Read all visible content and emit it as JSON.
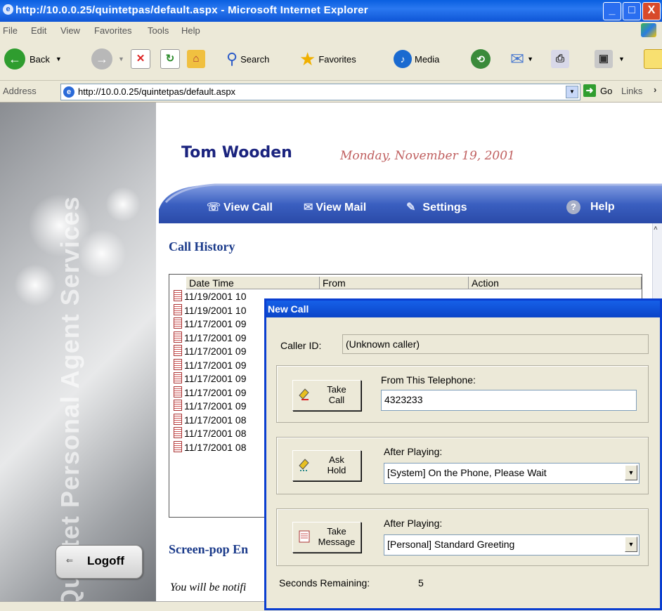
{
  "window": {
    "title": "http://10.0.0.25/quintetpas/default.aspx - Microsoft Internet Explorer"
  },
  "menu": [
    "File",
    "Edit",
    "View",
    "Favorites",
    "Tools",
    "Help"
  ],
  "toolbar": {
    "back": "Back",
    "search": "Search",
    "favorites": "Favorites",
    "media": "Media"
  },
  "address": {
    "label": "Address",
    "url": "http://10.0.0.25/quintetpas/default.aspx",
    "go": "Go",
    "links": "Links"
  },
  "sidebar": {
    "title": "Quintet Personal Agent Services",
    "logoff": "Logoff"
  },
  "page": {
    "user_name": "Tom Wooden",
    "date": "Monday, November 19, 2001",
    "nav": {
      "view_call": "View Call",
      "view_mail": "View Mail",
      "settings": "Settings",
      "help": "Help"
    },
    "call_history_title": "Call History",
    "columns": [
      "Date Time",
      "From",
      "Action"
    ],
    "rows": [
      "11/19/2001 10",
      "11/19/2001 10",
      "11/17/2001 09",
      "11/17/2001 09",
      "11/17/2001 09",
      "11/17/2001 09",
      "11/17/2001 09",
      "11/17/2001 09",
      "11/17/2001 09",
      "11/17/2001 08",
      "11/17/2001 08",
      "11/17/2001 08"
    ],
    "screenpop_title": "Screen-pop En",
    "notify_text": "You will be notifi"
  },
  "dialog": {
    "title": "New Call",
    "caller_id_label": "Caller ID:",
    "caller_id_value": "(Unknown caller)",
    "take_call": {
      "line1": "Take",
      "line2": "Call"
    },
    "from_label": "From This Telephone:",
    "from_value": "4323233",
    "ask_hold": {
      "line1": "Ask",
      "line2": "Hold"
    },
    "after_playing_label_1": "After Playing:",
    "after_playing_value_1": "[System] On the Phone, Please Wait",
    "take_message": {
      "line1": "Take",
      "line2": "Message"
    },
    "after_playing_label_2": "After Playing:",
    "after_playing_value_2": "[Personal] Standard Greeting",
    "seconds_label": "Seconds Remaining:",
    "seconds_value": "5"
  },
  "colors": {
    "title_bar": "#0a5fe0",
    "nav_bar": "#3a5fc0",
    "heading_blue": "#1a3a8a",
    "date_red": "#c06060"
  }
}
